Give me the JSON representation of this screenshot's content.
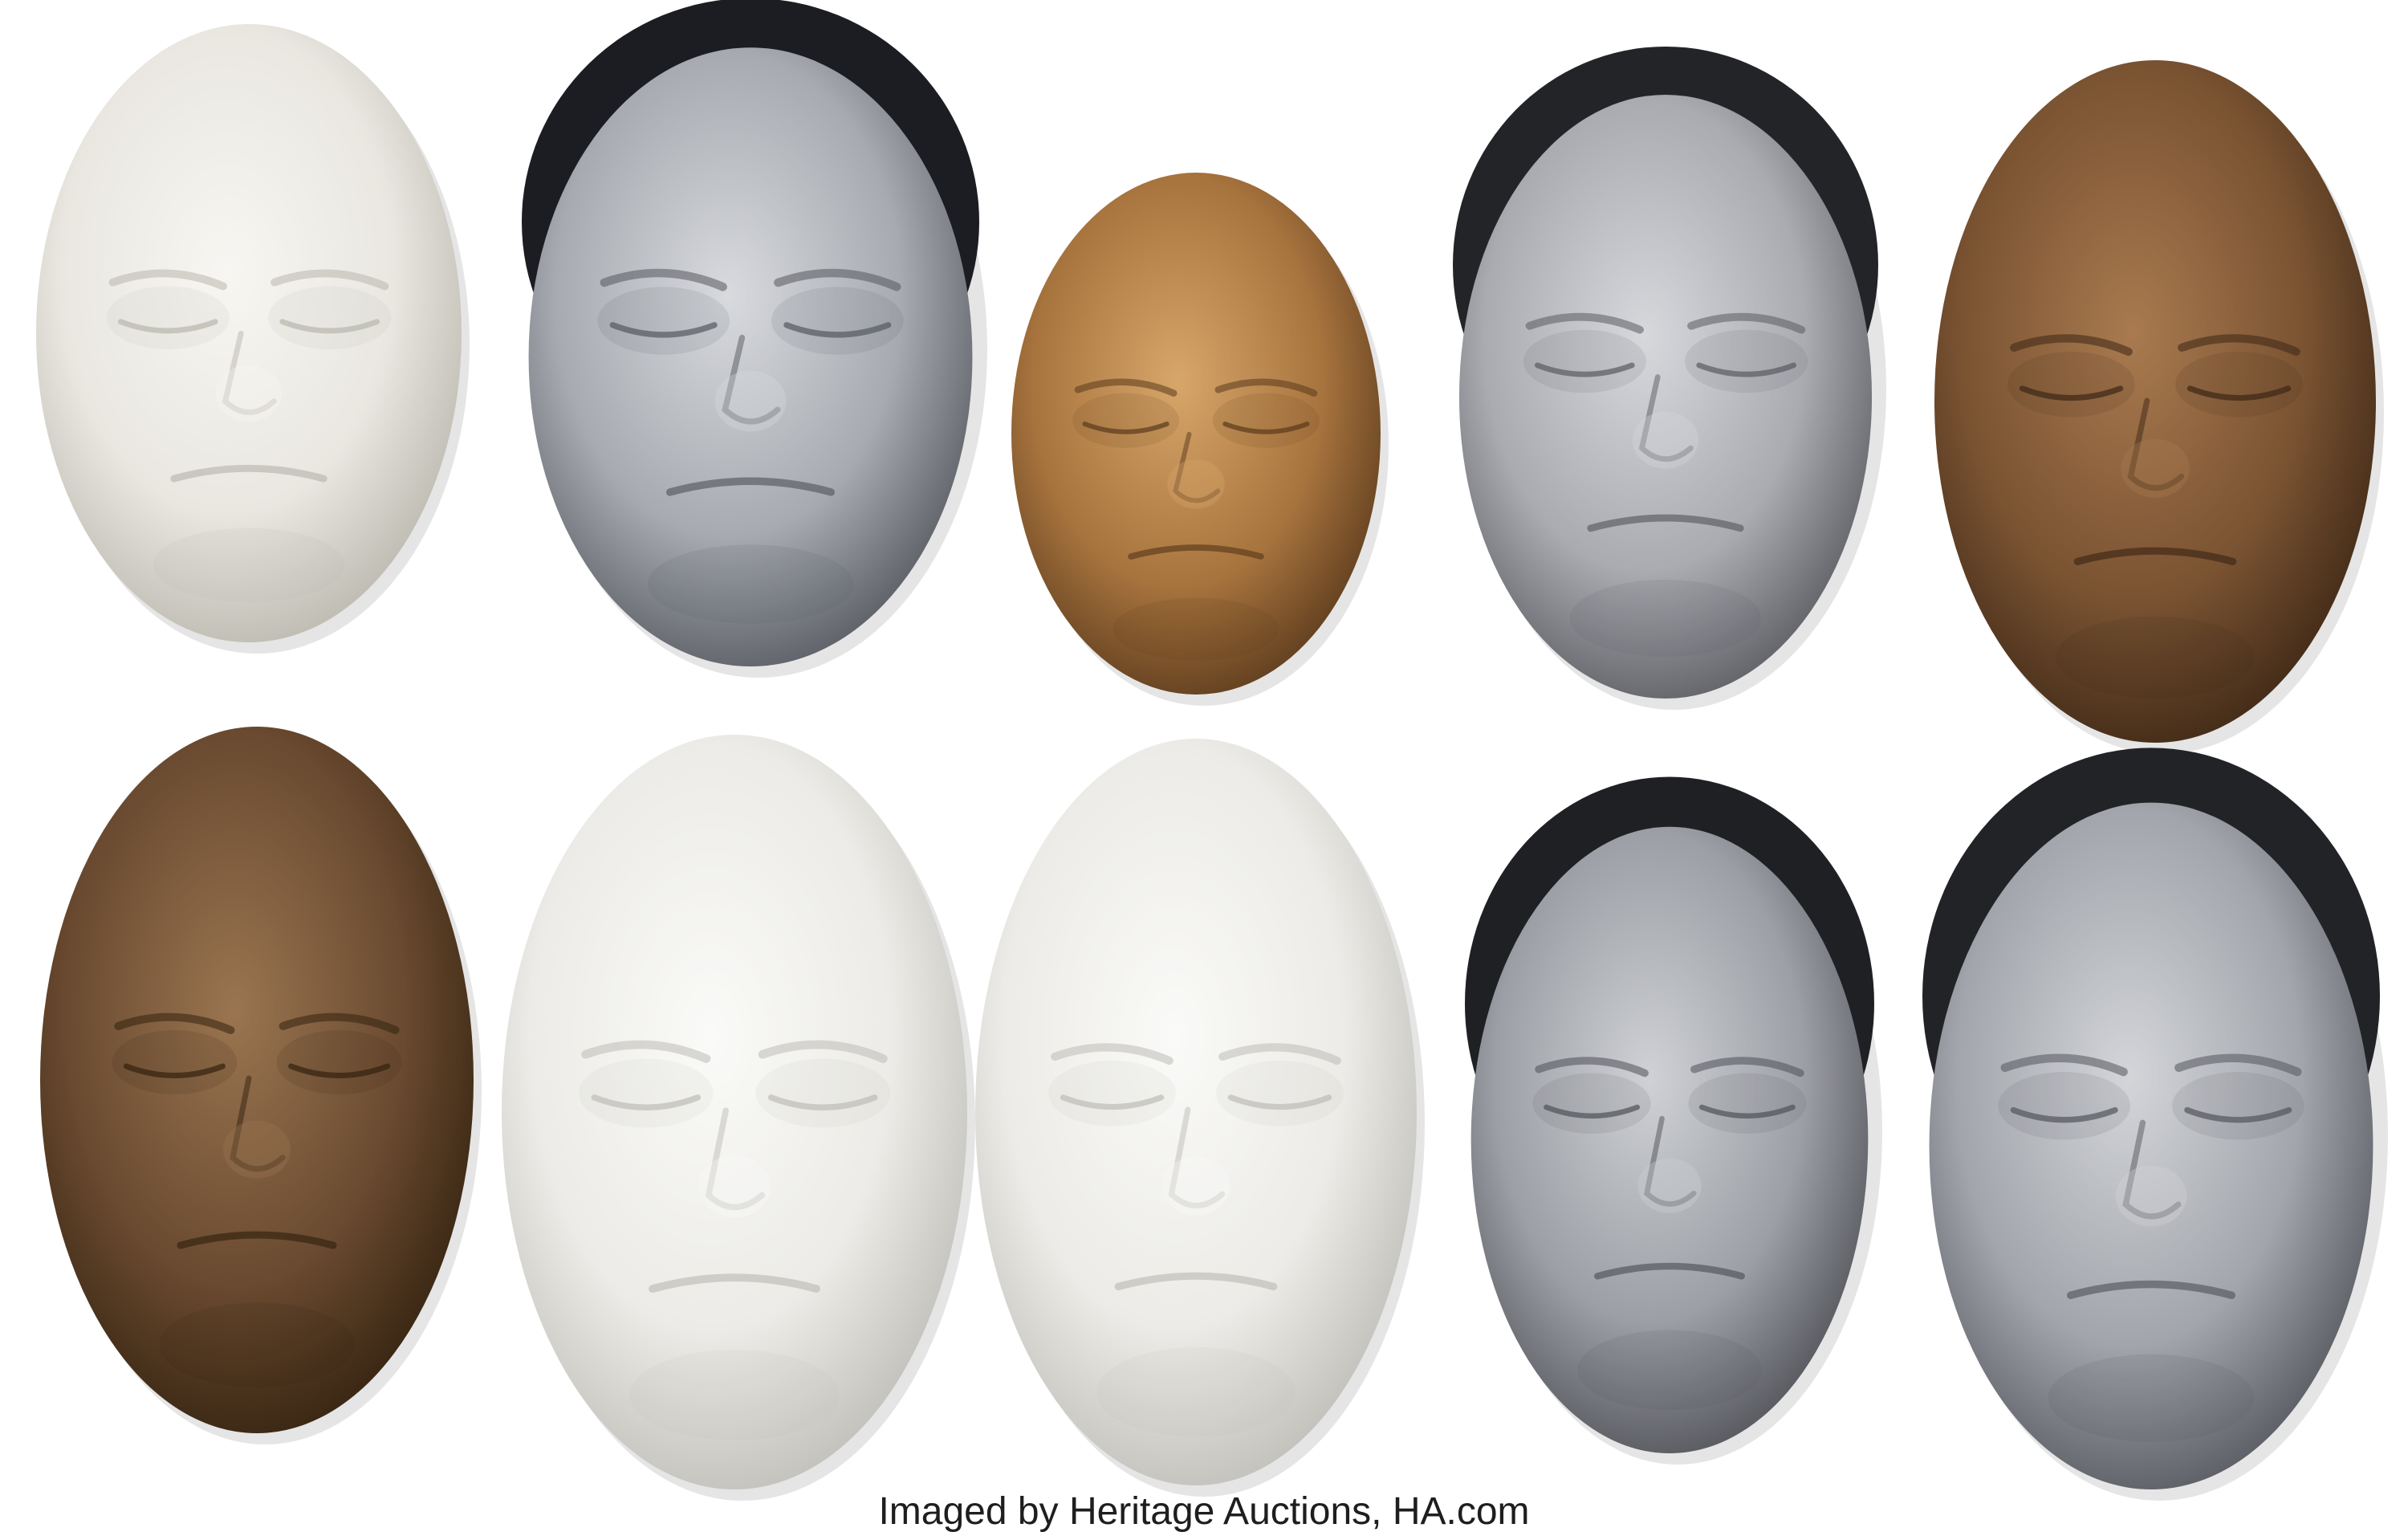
{
  "caption": "Imaged by Heritage Auctions, HA.com",
  "masks": [
    {
      "id": "mask-1",
      "finish": "white-plaster",
      "hair": false,
      "color": "#e9e7e0",
      "shade": "#b9b6ad",
      "light": "#f7f6f2"
    },
    {
      "id": "mask-2",
      "finish": "silver",
      "hair": true,
      "color": "#a7aab0",
      "shade": "#55585f",
      "light": "#d8dade",
      "hairColor": "#1c1d22"
    },
    {
      "id": "mask-3",
      "finish": "gold",
      "hair": false,
      "color": "#a8743e",
      "shade": "#5a3a1c",
      "light": "#d7a66a"
    },
    {
      "id": "mask-4",
      "finish": "silver",
      "hair": true,
      "color": "#a9abb0",
      "shade": "#595b61",
      "light": "#d6d8dc",
      "hairColor": "#232428"
    },
    {
      "id": "mask-5",
      "finish": "bronze",
      "hair": false,
      "color": "#7a5332",
      "shade": "#3d2715",
      "light": "#a97a4f"
    },
    {
      "id": "mask-6",
      "finish": "bronze",
      "hair": false,
      "color": "#6a4a30",
      "shade": "#33220f",
      "light": "#9a7550"
    },
    {
      "id": "mask-7",
      "finish": "white-plaster",
      "hair": false,
      "color": "#ecebe7",
      "shade": "#bdbcb6",
      "light": "#fafaf8"
    },
    {
      "id": "mask-8",
      "finish": "white-plaster",
      "hair": false,
      "color": "#ecebe7",
      "shade": "#bdbcb6",
      "light": "#fafaf8"
    },
    {
      "id": "mask-9",
      "finish": "silver",
      "hair": true,
      "color": "#9c9fa5",
      "shade": "#4f5157",
      "light": "#cfd1d5",
      "hairColor": "#1f2024"
    },
    {
      "id": "mask-10",
      "finish": "silver",
      "hair": true,
      "color": "#a2a5ab",
      "shade": "#53565c",
      "light": "#d3d5d9",
      "hairColor": "#222327"
    }
  ]
}
